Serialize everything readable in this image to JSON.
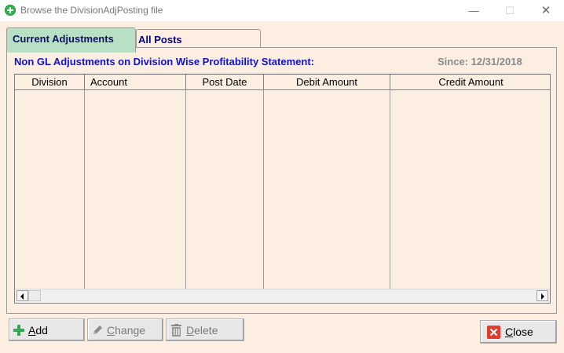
{
  "window": {
    "title": "Browse the DivisionAdjPosting file",
    "controls": {
      "minimize": "—",
      "maximize": "☐",
      "close": "✕"
    }
  },
  "tabs": [
    {
      "label": "Current Adjustments",
      "active": true
    },
    {
      "label": "All Posts",
      "active": false
    }
  ],
  "panel": {
    "heading": "Non GL Adjustments on Division Wise Profitability Statement:",
    "since": "Since: 12/31/2018"
  },
  "table": {
    "columns": [
      "Division",
      "Account",
      "Post Date",
      "Debit Amount",
      "Credit Amount"
    ],
    "rows": []
  },
  "buttons": {
    "add": {
      "label": "Add",
      "accel": "A",
      "rest": "dd",
      "enabled": true
    },
    "change": {
      "label": "Change",
      "accel": "C",
      "rest": "hange",
      "enabled": false
    },
    "delete": {
      "label": "Delete",
      "accel": "D",
      "rest": "elete",
      "enabled": false
    },
    "close": {
      "label": "Close",
      "accel": "C",
      "rest": "lose",
      "enabled": true
    }
  },
  "colors": {
    "background": "#fdeee2",
    "active_tab": "#b9dfc4",
    "heading_text": "#1010d0",
    "since_text": "#8a8a8a"
  },
  "icons": {
    "app": "green-plus-circle-icon",
    "add": "plus-icon",
    "change": "pencil-icon",
    "delete": "trash-icon",
    "close": "close-x-icon"
  }
}
